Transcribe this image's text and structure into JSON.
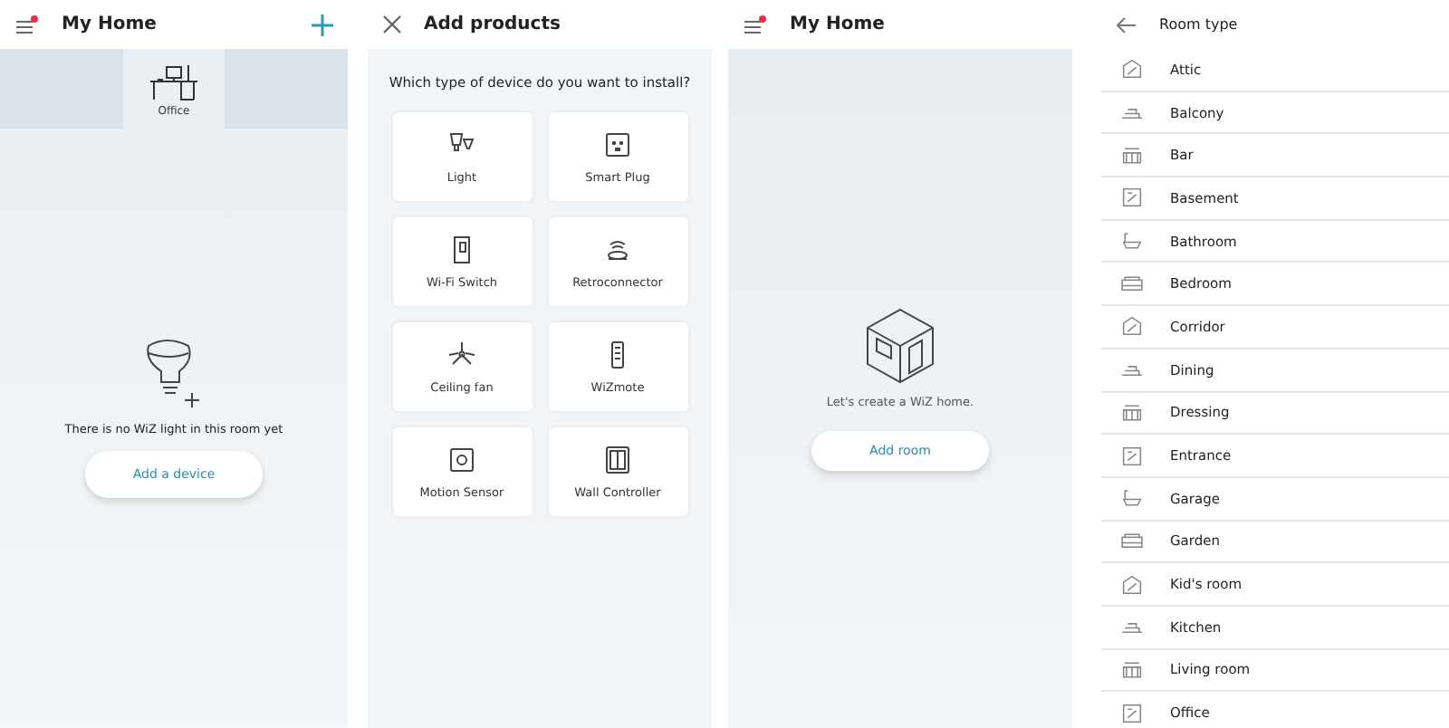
{
  "home_screen": {
    "title": "My Home",
    "rooms": [
      {
        "label": "Office",
        "selected": true
      }
    ],
    "message": "There is no WiZ light in this room yet",
    "button": "Add a device"
  },
  "add_products_screen": {
    "title": "Add products",
    "question": "Which type of device do you want to install?",
    "products": [
      {
        "label": "Light"
      },
      {
        "label": "Smart Plug"
      },
      {
        "label": "Wi-Fi Switch"
      },
      {
        "label": "Retroconnector"
      },
      {
        "label": "Ceiling fan"
      },
      {
        "label": "WiZmote"
      },
      {
        "label": "Motion Sensor"
      },
      {
        "label": "Wall Controller"
      }
    ]
  },
  "empty_home_screen": {
    "title": "My Home",
    "message": "Let's create a WiZ home.",
    "button": "Add room"
  },
  "room_type_screen": {
    "title": "Room type",
    "rooms": [
      {
        "label": "Attic"
      },
      {
        "label": "Balcony"
      },
      {
        "label": "Bar"
      },
      {
        "label": "Basement"
      },
      {
        "label": "Bathroom"
      },
      {
        "label": "Bedroom"
      },
      {
        "label": "Corridor"
      },
      {
        "label": "Dining"
      },
      {
        "label": "Dressing"
      },
      {
        "label": "Entrance"
      },
      {
        "label": "Garage"
      },
      {
        "label": "Garden"
      },
      {
        "label": "Kid's room"
      },
      {
        "label": "Kitchen"
      },
      {
        "label": "Living room"
      },
      {
        "label": "Office"
      }
    ]
  }
}
